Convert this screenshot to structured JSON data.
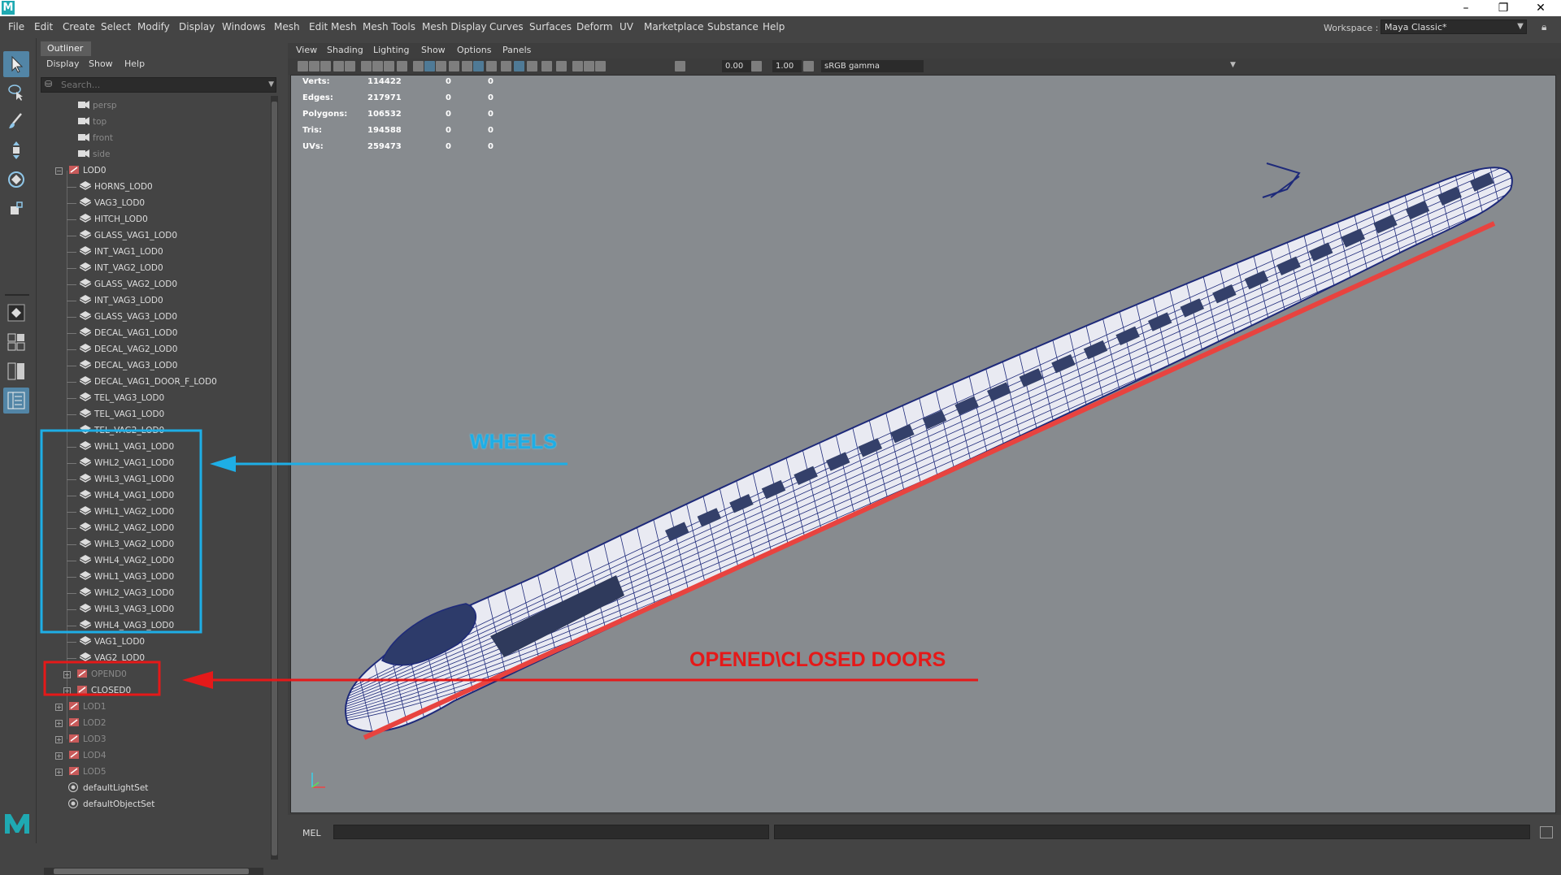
{
  "window": {
    "logo_letter": "M",
    "controls": [
      "–",
      "❐",
      "✕"
    ]
  },
  "menubar": {
    "items": [
      "File",
      "Edit",
      "Create",
      "Select",
      "Modify",
      "Display",
      "Windows",
      "Mesh",
      "Edit Mesh",
      "Mesh Tools",
      "Mesh Display",
      "Curves",
      "Surfaces",
      "Deform",
      "UV",
      "Marketplace",
      "Substance",
      "Help"
    ],
    "workspace_label": "Workspace :",
    "workspace_value": "Maya Classic*"
  },
  "toolbox": {
    "tools": [
      "select-tool",
      "lasso-tool",
      "paint-select-tool",
      "move-tool",
      "rotate-tool",
      "scale-tool"
    ],
    "layouts": [
      "single-pane-layout",
      "four-pane-layout",
      "two-pane-layout",
      "outliner-layout"
    ]
  },
  "outliner": {
    "tab": "Outliner",
    "menus": [
      "Display",
      "Show",
      "Help"
    ],
    "search_placeholder": "Search...",
    "rows": [
      {
        "label": "persp",
        "type": "camera",
        "level": 1,
        "dim": true
      },
      {
        "label": "top",
        "type": "camera",
        "level": 1,
        "dim": true
      },
      {
        "label": "front",
        "type": "camera",
        "level": 1,
        "dim": true
      },
      {
        "label": "side",
        "type": "camera",
        "level": 1,
        "dim": true
      },
      {
        "label": "LOD0",
        "type": "group",
        "level": 0,
        "expander": "−"
      },
      {
        "label": "HORNS_LOD0",
        "type": "mesh",
        "level": 2
      },
      {
        "label": "VAG3_LOD0",
        "type": "mesh",
        "level": 2
      },
      {
        "label": "HITCH_LOD0",
        "type": "mesh",
        "level": 2
      },
      {
        "label": "GLASS_VAG1_LOD0",
        "type": "mesh",
        "level": 2
      },
      {
        "label": "INT_VAG1_LOD0",
        "type": "mesh",
        "level": 2
      },
      {
        "label": "INT_VAG2_LOD0",
        "type": "mesh",
        "level": 2
      },
      {
        "label": "GLASS_VAG2_LOD0",
        "type": "mesh",
        "level": 2
      },
      {
        "label": "INT_VAG3_LOD0",
        "type": "mesh",
        "level": 2
      },
      {
        "label": "GLASS_VAG3_LOD0",
        "type": "mesh",
        "level": 2
      },
      {
        "label": "DECAL_VAG1_LOD0",
        "type": "mesh",
        "level": 2
      },
      {
        "label": "DECAL_VAG2_LOD0",
        "type": "mesh",
        "level": 2
      },
      {
        "label": "DECAL_VAG3_LOD0",
        "type": "mesh",
        "level": 2
      },
      {
        "label": "DECAL_VAG1_DOOR_F_LOD0",
        "type": "mesh",
        "level": 2
      },
      {
        "label": "TEL_VAG3_LOD0",
        "type": "mesh",
        "level": 2
      },
      {
        "label": "TEL_VAG1_LOD0",
        "type": "mesh",
        "level": 2
      },
      {
        "label": "TEL_VAG2_LOD0",
        "type": "mesh",
        "level": 2
      },
      {
        "label": "WHL1_VAG1_LOD0",
        "type": "mesh",
        "level": 2
      },
      {
        "label": "WHL2_VAG1_LOD0",
        "type": "mesh",
        "level": 2
      },
      {
        "label": "WHL3_VAG1_LOD0",
        "type": "mesh",
        "level": 2
      },
      {
        "label": "WHL4_VAG1_LOD0",
        "type": "mesh",
        "level": 2
      },
      {
        "label": "WHL1_VAG2_LOD0",
        "type": "mesh",
        "level": 2
      },
      {
        "label": "WHL2_VAG2_LOD0",
        "type": "mesh",
        "level": 2
      },
      {
        "label": "WHL3_VAG2_LOD0",
        "type": "mesh",
        "level": 2
      },
      {
        "label": "WHL4_VAG2_LOD0",
        "type": "mesh",
        "level": 2
      },
      {
        "label": "WHL1_VAG3_LOD0",
        "type": "mesh",
        "level": 2
      },
      {
        "label": "WHL2_VAG3_LOD0",
        "type": "mesh",
        "level": 2
      },
      {
        "label": "WHL3_VAG3_LOD0",
        "type": "mesh",
        "level": 2
      },
      {
        "label": "WHL4_VAG3_LOD0",
        "type": "mesh",
        "level": 2
      },
      {
        "label": "VAG1_LOD0",
        "type": "mesh",
        "level": 2
      },
      {
        "label": "VAG2_LOD0",
        "type": "mesh",
        "level": 2
      },
      {
        "label": "OPEND0",
        "type": "group",
        "level": 1,
        "expander": "+",
        "dim": true
      },
      {
        "label": "CLOSED0",
        "type": "group",
        "level": 1,
        "expander": "+"
      },
      {
        "label": "LOD1",
        "type": "group",
        "level": 0,
        "expander": "+",
        "dim": true
      },
      {
        "label": "LOD2",
        "type": "group",
        "level": 0,
        "expander": "+",
        "dim": true
      },
      {
        "label": "LOD3",
        "type": "group",
        "level": 0,
        "expander": "+",
        "dim": true
      },
      {
        "label": "LOD4",
        "type": "group",
        "level": 0,
        "expander": "+",
        "dim": true
      },
      {
        "label": "LOD5",
        "type": "group",
        "level": 0,
        "expander": "+",
        "dim": true
      },
      {
        "label": "defaultLightSet",
        "type": "set",
        "level": 0
      },
      {
        "label": "defaultObjectSet",
        "type": "set",
        "level": 0
      }
    ]
  },
  "viewport": {
    "menus": [
      "View",
      "Shading",
      "Lighting",
      "Show",
      "Options",
      "Panels"
    ],
    "exposure": "0.00",
    "gamma": "1.00",
    "color_space": "sRGB gamma",
    "hud": [
      {
        "label": "Verts:",
        "values": [
          "114422",
          "0",
          "0"
        ]
      },
      {
        "label": "Edges:",
        "values": [
          "217971",
          "0",
          "0"
        ]
      },
      {
        "label": "Polygons:",
        "values": [
          "106532",
          "0",
          "0"
        ]
      },
      {
        "label": "Tris:",
        "values": [
          "194588",
          "0",
          "0"
        ]
      },
      {
        "label": "UVs:",
        "values": [
          "259473",
          "0",
          "0"
        ]
      }
    ],
    "background_color": "#878b8f",
    "wire_color": "#1e2a7a",
    "stripe_color": "#e8433f"
  },
  "annotations": {
    "wheels": {
      "text": "WHEELS",
      "color": "#1eaee6"
    },
    "doors": {
      "text": "OPENED\\CLOSED DOORS",
      "color": "#e51919"
    }
  },
  "cmdline": {
    "label": "MEL"
  }
}
